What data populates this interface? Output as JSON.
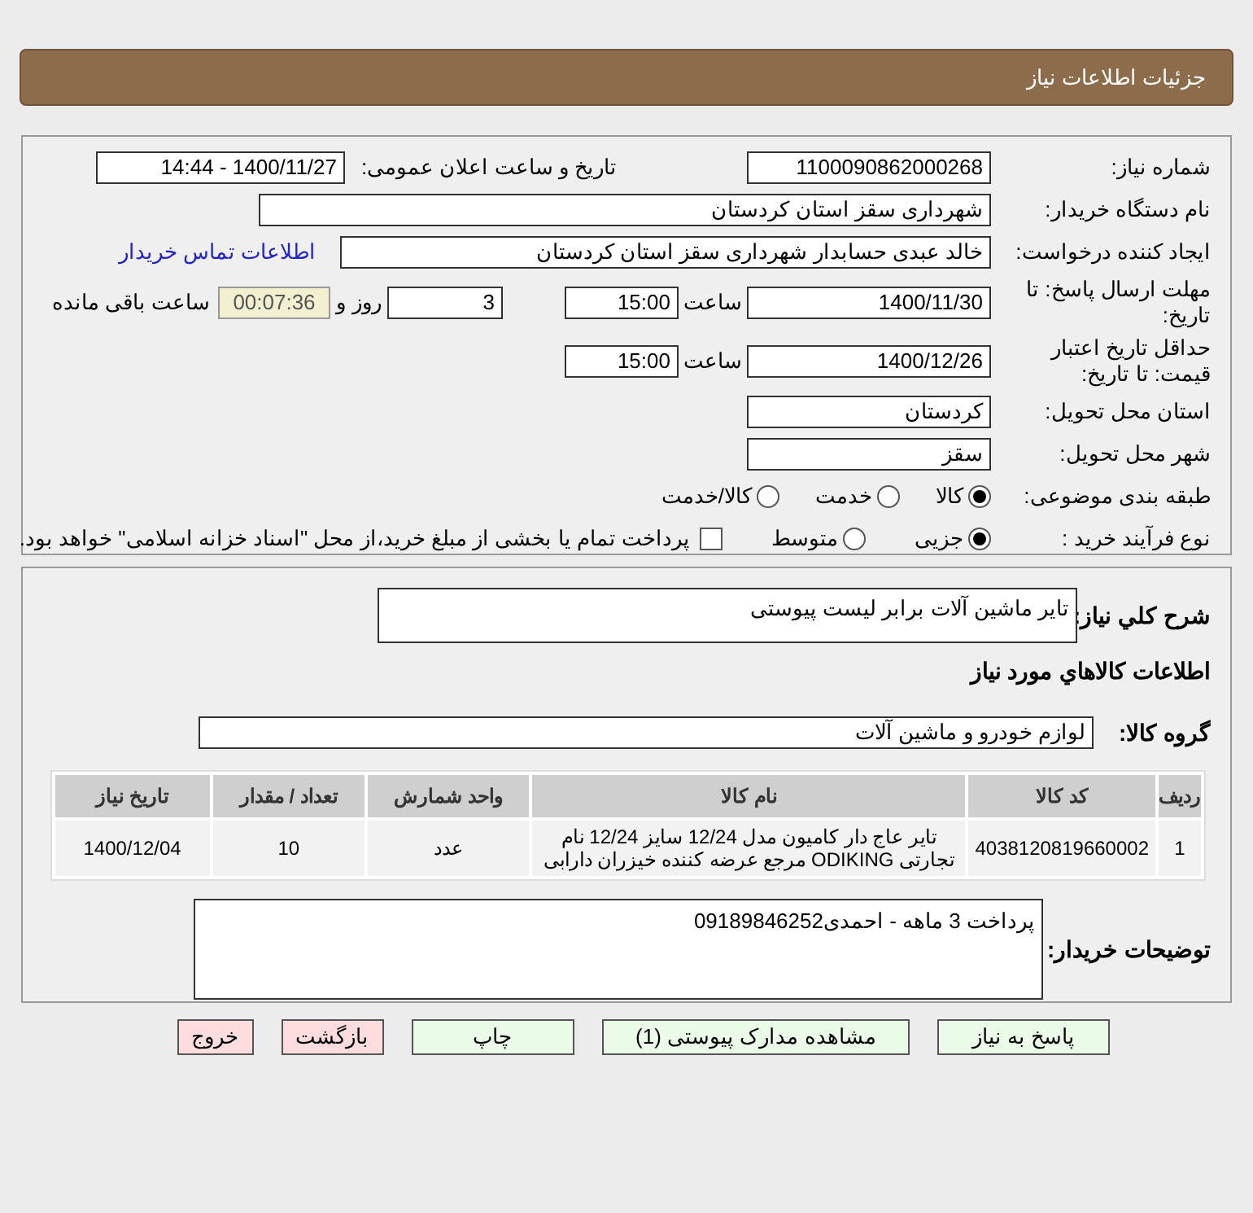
{
  "header": {
    "title": "جزئیات اطلاعات نیاز"
  },
  "details": {
    "need_number": {
      "label": "شماره نیاز:",
      "value": "1100090862000268"
    },
    "announce": {
      "label": "تاریخ و ساعت اعلان عمومی:",
      "value": "1400/11/27 - 14:44"
    },
    "buyer_org": {
      "label": "نام دستگاه خریدار:",
      "value": "شهرداری سقز استان کردستان"
    },
    "creator": {
      "label": "ایجاد کننده درخواست:",
      "value": "خالد عبدی حسابدار شهرداری سقز استان کردستان",
      "link": "اطلاعات تماس خریدار"
    },
    "deadline": {
      "label": "مهلت ارسال پاسخ: تا تاریخ:",
      "date": "1400/11/30",
      "time_label": "ساعت",
      "time": "15:00",
      "days": "3",
      "days_label": "روز و",
      "remaining": "00:07:36",
      "remaining_label": "ساعت باقی مانده"
    },
    "validity": {
      "label": "حداقل تاریخ اعتبار قیمت: تا تاریخ:",
      "date": "1400/12/26",
      "time_label": "ساعت",
      "time": "15:00"
    },
    "province": {
      "label": "استان محل تحویل:",
      "value": "کردستان"
    },
    "city": {
      "label": "شهر محل تحویل:",
      "value": "سقز"
    },
    "category": {
      "label": "طبقه بندی موضوعی:",
      "options": [
        {
          "label": "کالا",
          "selected": true
        },
        {
          "label": "خدمت",
          "selected": false
        },
        {
          "label": "کالا/خدمت",
          "selected": false
        }
      ]
    },
    "process": {
      "label": "نوع فرآیند خرید :",
      "options": [
        {
          "label": "جزیی",
          "selected": true
        },
        {
          "label": "متوسط",
          "selected": false
        }
      ],
      "payment": {
        "label": "پرداخت تمام یا بخشی از مبلغ خرید،از محل \"اسناد خزانه اسلامی\" خواهد بود.",
        "checked": false
      }
    }
  },
  "summary": {
    "label": "شرح كلي نياز:",
    "value": "تایر ماشین آلات برابر لیست پیوستی"
  },
  "items_title": "اطلاعات كالاهاي مورد نياز",
  "goods_group": {
    "label": "گروه کالا:",
    "value": "لوازم خودرو و ماشین آلات"
  },
  "table": {
    "columns": [
      "ردیف",
      "کد کالا",
      "نام کالا",
      "واحد شمارش",
      "تعداد / مقدار",
      "تاریخ نیاز"
    ],
    "rows": [
      [
        "1",
        "4038120819660002",
        "تایر عاج دار کامیون مدل 12/24 سایز 12/24 نام تجارتی ODIKING مرجع عرضه کننده خیزران دارابی",
        "عدد",
        "10",
        "1400/12/04"
      ]
    ]
  },
  "notes": {
    "label": "توضیحات خریدار:",
    "value": "پرداخت 3 ماهه - احمدی09189846252"
  },
  "buttons": [
    {
      "label": "پاسخ به نیاز",
      "kind": "normal"
    },
    {
      "label": "مشاهده مدارک پیوستی (1)",
      "kind": "normal"
    },
    {
      "label": "چاپ",
      "kind": "normal"
    },
    {
      "label": "بازگشت",
      "kind": "exit"
    },
    {
      "label": "خروج",
      "kind": "exit"
    }
  ]
}
